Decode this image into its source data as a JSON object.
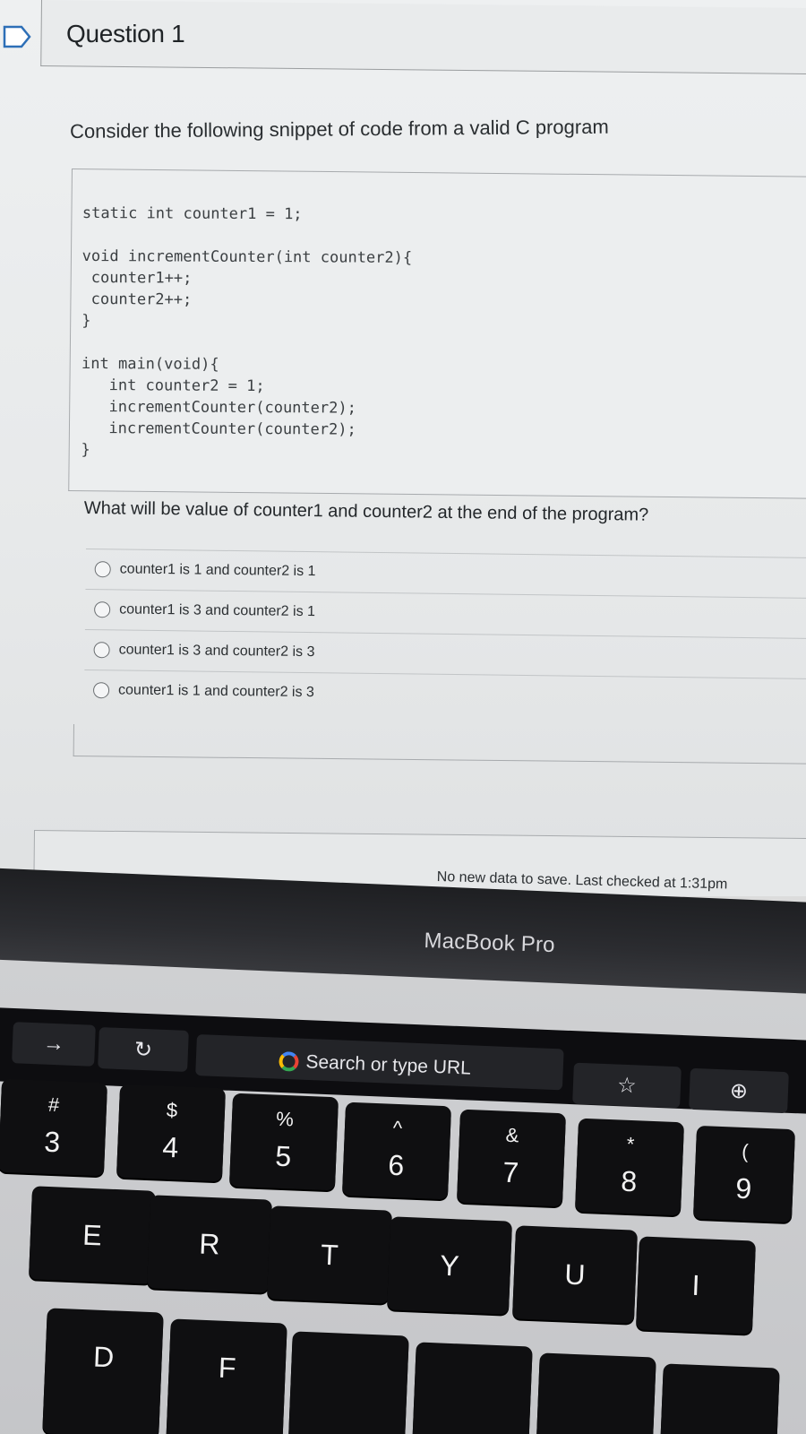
{
  "quiz": {
    "question_title": "Question 1",
    "prompt": "Consider the following snippet of code from a valid C program",
    "code_lines": [
      "static int counter1 = 1;",
      "",
      "void incrementCounter(int counter2){",
      " counter1++;",
      " counter2++;",
      "}",
      "",
      "int main(void){",
      "   int counter2 = 1;",
      "   incrementCounter(counter2);",
      "   incrementCounter(counter2);",
      "}"
    ],
    "question": "What will be value of counter1 and counter2  at the end of the program?",
    "options": [
      "counter1 is 1 and counter2 is 1",
      "counter1 is 3 and counter2 is 1",
      "counter1 is 3 and counter2 is 3",
      "counter1 is 1 and counter2 is 3"
    ],
    "status": "No new data to save. Last checked at 1:31pm"
  },
  "laptop": {
    "brand": "MacBook Pro",
    "touchbar": {
      "search_text": "Search or type URL"
    },
    "number_row": [
      {
        "top": "#",
        "bottom": "3"
      },
      {
        "top": "$",
        "bottom": "4"
      },
      {
        "top": "%",
        "bottom": "5"
      },
      {
        "top": "^",
        "bottom": "6"
      },
      {
        "top": "&",
        "bottom": "7"
      },
      {
        "top": "*",
        "bottom": "8"
      },
      {
        "top": "(",
        "bottom": "9"
      }
    ],
    "letter_row": [
      "E",
      "R",
      "T",
      "Y",
      "U",
      "I"
    ],
    "home_row": [
      "D",
      "F"
    ]
  }
}
